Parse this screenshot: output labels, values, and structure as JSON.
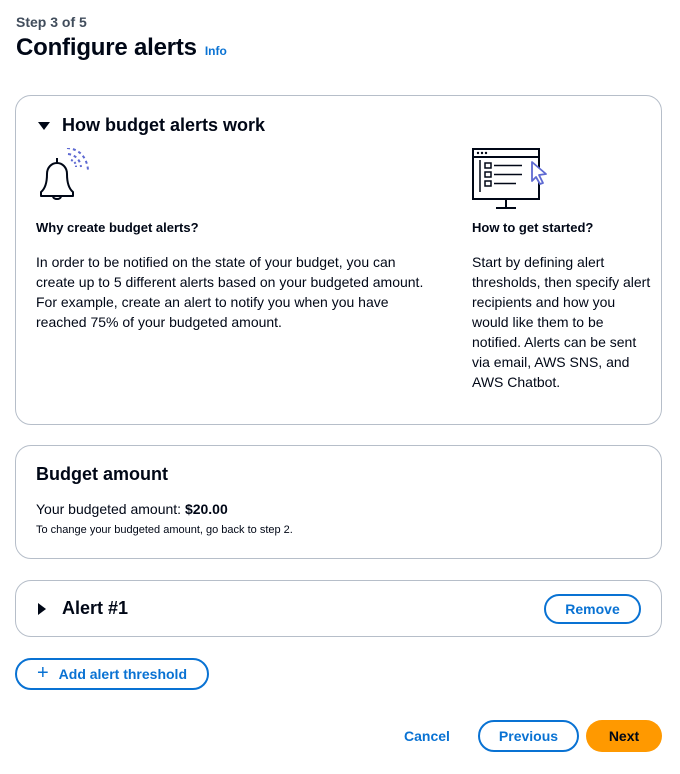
{
  "header": {
    "step": "Step 3 of 5",
    "title": "Configure alerts",
    "info": "Info"
  },
  "how_it_works": {
    "title": "How budget alerts work",
    "expanded": true,
    "left": {
      "icon": "bell-icon",
      "heading": "Why create budget alerts?",
      "body": "In order to be notified on the state of your budget, you can create up to 5 different alerts based on your budgeted amount. For example, create an alert to notify you when you have reached 75% of your budgeted amount."
    },
    "right": {
      "icon": "monitor-checklist-icon",
      "heading": "How to get started?",
      "body": "Start by defining alert thresholds, then specify alert recipients and how you would like them to be notified. Alerts can be sent via email, AWS SNS, and AWS Chatbot."
    }
  },
  "budget": {
    "title": "Budget amount",
    "label": "Your budgeted amount: ",
    "amount": "$20.00",
    "hint": "To change your budgeted amount, go back to step 2."
  },
  "alert": {
    "title": "Alert #1",
    "expanded": false,
    "remove_label": "Remove"
  },
  "add_threshold_label": "Add alert threshold",
  "footer": {
    "cancel": "Cancel",
    "previous": "Previous",
    "next": "Next"
  },
  "colors": {
    "link": "#0972d3",
    "primary_button": "#ff9900",
    "border": "#b6bec9"
  }
}
